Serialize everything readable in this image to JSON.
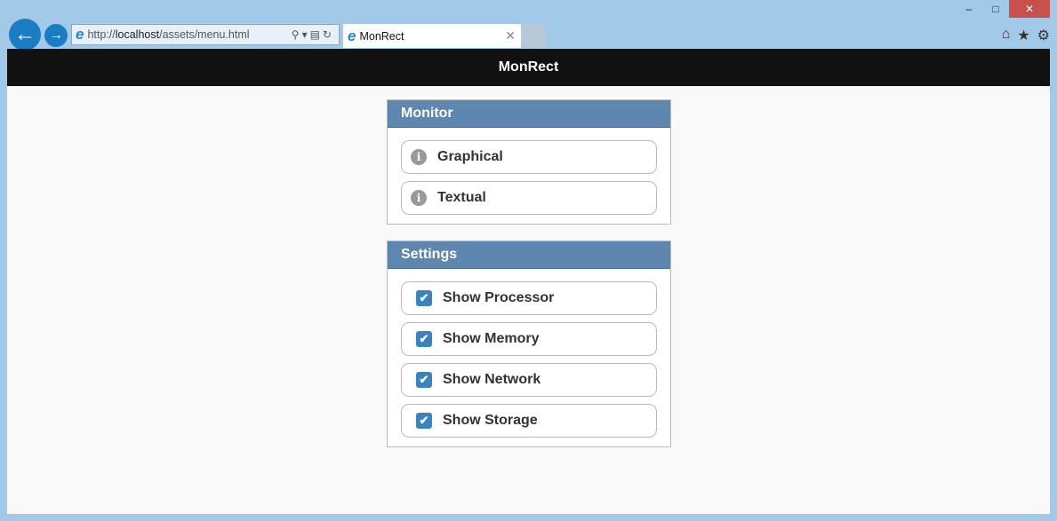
{
  "browser": {
    "url_prefix": "http://",
    "url_host": "localhost",
    "url_path": "/assets/menu.html",
    "tab_title": "MonRect"
  },
  "app": {
    "title": "MonRect"
  },
  "monitor": {
    "title": "Monitor",
    "items": [
      {
        "label": "Graphical"
      },
      {
        "label": "Textual"
      }
    ]
  },
  "settings": {
    "title": "Settings",
    "items": [
      {
        "label": "Show Processor",
        "checked": true
      },
      {
        "label": "Show Memory",
        "checked": true
      },
      {
        "label": "Show Network",
        "checked": true
      },
      {
        "label": "Show Storage",
        "checked": true
      }
    ]
  }
}
